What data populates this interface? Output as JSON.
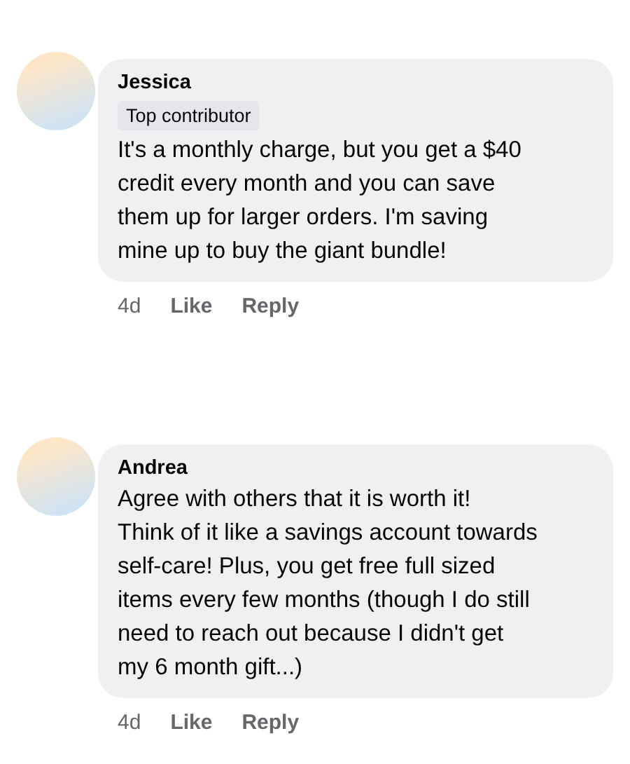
{
  "comments": [
    {
      "author": "Jessica",
      "badge": "Top contributor",
      "lines": [
        "It's a monthly charge, but you get a $40",
        "credit every month and you can save",
        "them up for larger orders. I'm saving",
        "mine up to buy the giant bundle!"
      ],
      "time": "4d",
      "actions": [
        "Like",
        "Reply"
      ]
    },
    {
      "author": "Andrea",
      "lines": [
        "Agree with others that it is worth it!",
        "Think of it like a savings account towards",
        "self-care! Plus, you get free full sized",
        "items every few months (though I do still",
        "need to reach out because I didn't get",
        "my 6 month gift...)"
      ],
      "time": "4d",
      "actions": [
        "Like",
        "Reply"
      ]
    }
  ]
}
